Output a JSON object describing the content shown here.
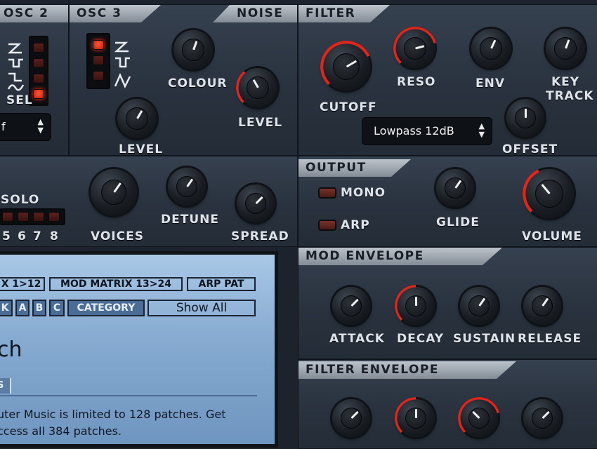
{
  "osc2": {
    "title": "OSC 2",
    "sel_label": "SEL",
    "select_value": "f"
  },
  "osc3": {
    "title": "OSC 3",
    "colour_label": "COLOUR",
    "level_label": "LEVEL"
  },
  "noise": {
    "title": "NOISE",
    "level_label": "LEVEL"
  },
  "filter": {
    "title": "FILTER",
    "cutoff_label": "CUTOFF",
    "reso_label": "RESO",
    "env_label": "ENV",
    "keytrack_label_1": "KEY",
    "keytrack_label_2": "TRACK",
    "offset_label": "OFFSET",
    "type_value": "Lowpass 12dB"
  },
  "unison": {
    "solo_label": "SOLO",
    "voices_label": "VOICES",
    "detune_label": "DETUNE",
    "spread_label": "SPREAD",
    "voice_numbers": [
      "5",
      "6",
      "7",
      "8"
    ]
  },
  "output": {
    "title": "OUTPUT",
    "mono_label": "MONO",
    "arp_label": "ARP",
    "glide_label": "GLIDE",
    "volume_label": "VOLUME"
  },
  "mod_envelope": {
    "title": "MOD ENVELOPE",
    "attack_label": "ATTACK",
    "decay_label": "DECAY",
    "sustain_label": "SUSTAIN",
    "release_label": "RELEASE"
  },
  "filter_envelope": {
    "title": "FILTER ENVELOPE"
  },
  "browser": {
    "tabs": [
      "X 1>12",
      "MOD MATRIX 13>24",
      "ARP PAT"
    ],
    "filter_buttons": [
      "K",
      "A",
      "B",
      "C"
    ],
    "category_label": "CATEGORY",
    "show_all": "Show All",
    "heading": "ch",
    "column_header": "S",
    "message_1": "uter Music is limited to 128 patches. Get",
    "message_2": "ccess all 384 patches."
  },
  "colors": {
    "accent_red": "#e0261a",
    "panel": "#2c3542",
    "lcd": "#8fb2d6"
  }
}
